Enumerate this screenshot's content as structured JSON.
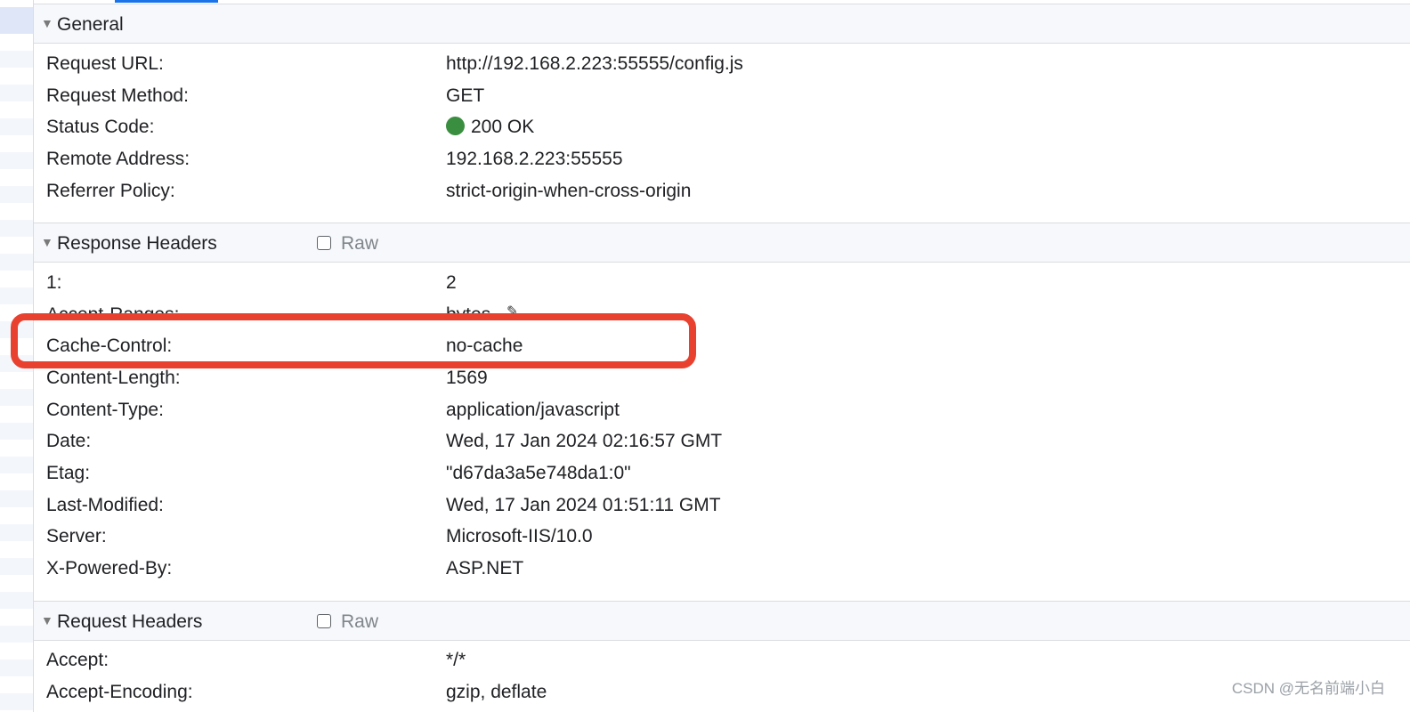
{
  "general": {
    "title": "General",
    "rows": [
      {
        "key": "Request URL:",
        "value": "http://192.168.2.223:55555/config.js"
      },
      {
        "key": "Request Method:",
        "value": "GET"
      },
      {
        "key": "Status Code:",
        "value": "200 OK"
      },
      {
        "key": "Remote Address:",
        "value": "192.168.2.223:55555"
      },
      {
        "key": "Referrer Policy:",
        "value": "strict-origin-when-cross-origin"
      }
    ],
    "status_color": "#3a8e3f"
  },
  "response_headers": {
    "title": "Response Headers",
    "raw_label": "Raw",
    "rows": [
      {
        "key": "1:",
        "value": "2"
      },
      {
        "key": "Accept-Ranges:",
        "value": "bytes"
      },
      {
        "key": "Cache-Control:",
        "value": "no-cache"
      },
      {
        "key": "Content-Length:",
        "value": "1569"
      },
      {
        "key": "Content-Type:",
        "value": "application/javascript"
      },
      {
        "key": "Date:",
        "value": "Wed, 17 Jan 2024 02:16:57 GMT"
      },
      {
        "key": "Etag:",
        "value": "\"d67da3a5e748da1:0\""
      },
      {
        "key": "Last-Modified:",
        "value": "Wed, 17 Jan 2024 01:51:11 GMT"
      },
      {
        "key": "Server:",
        "value": "Microsoft-IIS/10.0"
      },
      {
        "key": "X-Powered-By:",
        "value": "ASP.NET"
      }
    ]
  },
  "request_headers": {
    "title": "Request Headers",
    "raw_label": "Raw",
    "rows": [
      {
        "key": "Accept:",
        "value": "*/*"
      },
      {
        "key": "Accept-Encoding:",
        "value": "gzip, deflate"
      }
    ]
  },
  "annotation": {
    "highlight_color": "#e8412f"
  },
  "watermark": "CSDN @无名前端小白",
  "icons": {
    "collapse": "triangle-down-icon",
    "edit": "pencil-icon",
    "status": "status-dot-icon"
  }
}
